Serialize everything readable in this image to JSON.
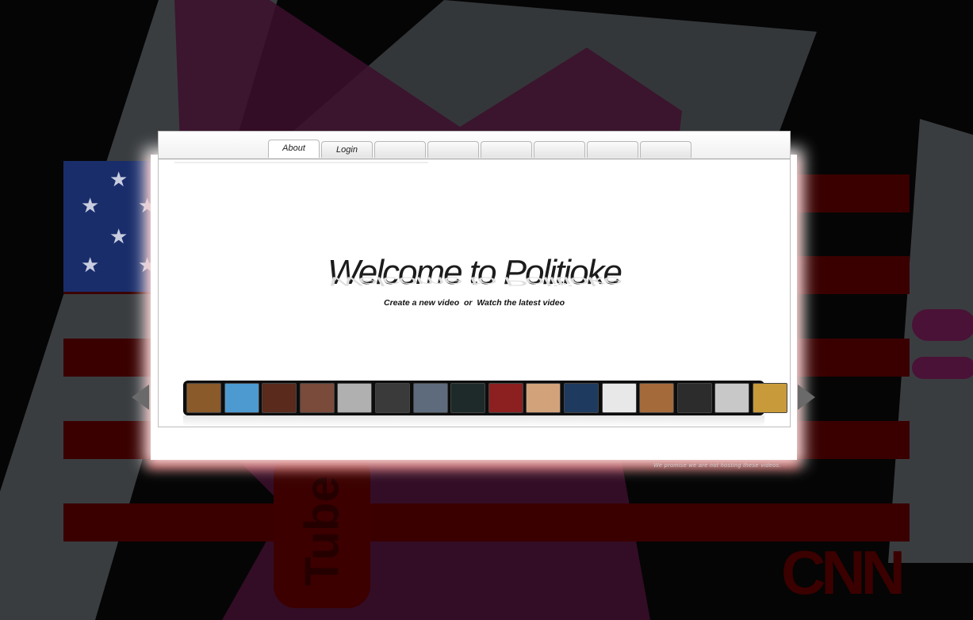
{
  "tabs": [
    {
      "label": "About",
      "active": true
    },
    {
      "label": "Login",
      "active": false
    },
    {
      "label": "",
      "active": false
    },
    {
      "label": "",
      "active": false
    },
    {
      "label": "",
      "active": false
    },
    {
      "label": "",
      "active": false
    },
    {
      "label": "",
      "active": false
    },
    {
      "label": "",
      "active": false
    }
  ],
  "hero": {
    "title": "Welcome to Politioke",
    "create_link": "Create a new video",
    "separator": "or",
    "watch_link": "Watch the latest video"
  },
  "thumbnails": [
    {
      "icon": "video-thumbnail",
      "color": "#8a5a2b"
    },
    {
      "icon": "video-thumbnail",
      "color": "#4d9ad1"
    },
    {
      "icon": "video-thumbnail",
      "color": "#5a2a1c"
    },
    {
      "icon": "video-thumbnail",
      "color": "#7a4a3a"
    },
    {
      "icon": "video-thumbnail",
      "color": "#b0b0b0"
    },
    {
      "icon": "video-thumbnail",
      "color": "#3a3a3a"
    },
    {
      "icon": "video-thumbnail",
      "color": "#5e6b7c"
    },
    {
      "icon": "video-thumbnail",
      "color": "#1e2a2a"
    },
    {
      "icon": "video-thumbnail",
      "color": "#8c2020"
    },
    {
      "icon": "video-thumbnail",
      "color": "#d2a27a"
    },
    {
      "icon": "video-thumbnail",
      "color": "#1f3a5f"
    },
    {
      "icon": "video-thumbnail",
      "color": "#e8e8e8"
    },
    {
      "icon": "video-thumbnail",
      "color": "#a56a3a"
    },
    {
      "icon": "video-thumbnail",
      "color": "#2c2c2c"
    },
    {
      "icon": "video-thumbnail",
      "color": "#c8c8c8"
    },
    {
      "icon": "video-thumbnail",
      "color": "#c99a3a"
    }
  ],
  "footer_note": "We promise we are not hosting these videos.",
  "background": {
    "youtube_text": "Tube",
    "cnn_text": "CNN"
  },
  "colors": {
    "flag_red": "#3a0000",
    "flag_blue": "#1a2d6b",
    "glow_red": "#c80000"
  }
}
